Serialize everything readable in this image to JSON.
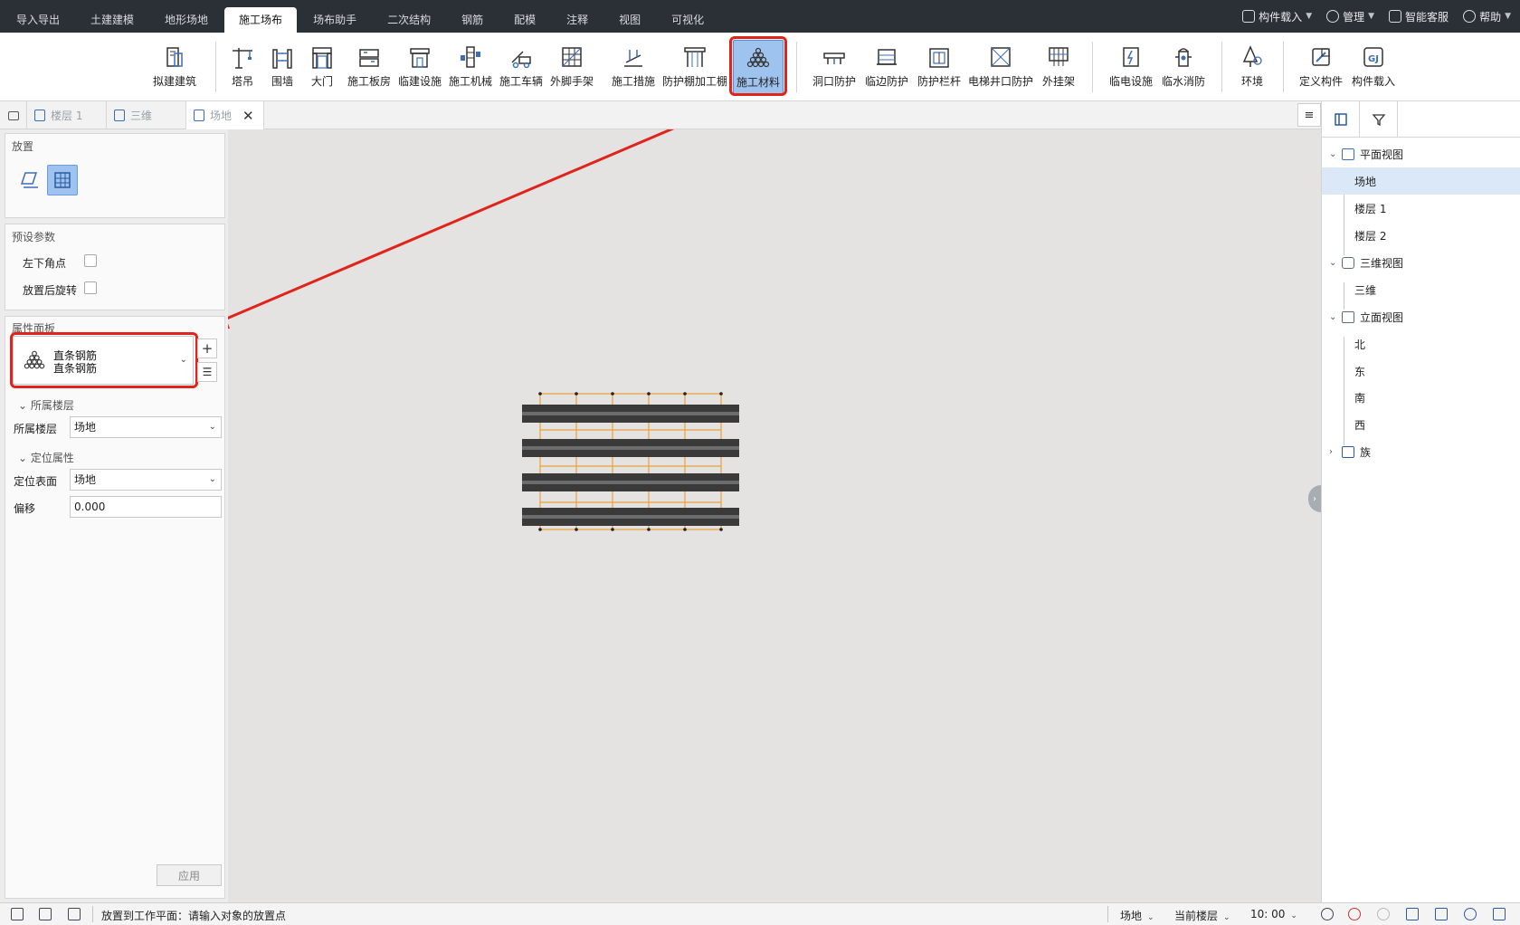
{
  "menubar": {
    "tabs": [
      "导入导出",
      "土建建模",
      "地形场地",
      "施工场布",
      "场布助手",
      "二次结构",
      "钢筋",
      "配模",
      "注释",
      "视图",
      "可视化"
    ],
    "active_tab": "施工场布",
    "right": {
      "component_load": "构件载入",
      "manage": "管理",
      "service": "智能客服",
      "help": "帮助"
    }
  },
  "ribbon": {
    "buttons": [
      "拟建建筑",
      "塔吊",
      "围墙",
      "大门",
      "施工板房",
      "临建设施",
      "施工机械",
      "施工车辆",
      "外脚手架",
      "施工措施",
      "防护棚加工棚",
      "施工材料",
      "洞口防护",
      "临边防护",
      "防护栏杆",
      "电梯井口防护",
      "外挂架",
      "临电设施",
      "临水消防",
      "环境",
      "定义构件",
      "构件载入"
    ],
    "active": "施工材料"
  },
  "doc_tabs": [
    "楼层 1",
    "三维",
    "场地"
  ],
  "active_doc_tab": "场地",
  "left_panel": {
    "place_title": "放置",
    "preset_title": "预设参数",
    "preset_options": [
      "左下角点",
      "放置后旋转"
    ],
    "props_title": "属性面板",
    "type_line1": "直条钢筋",
    "type_line2": "直条钢筋",
    "group_floor": "所属楼层",
    "floor_label": "所属楼层",
    "floor_value": "场地",
    "group_position": "定位属性",
    "surface_label": "定位表面",
    "surface_value": "场地",
    "offset_label": "偏移",
    "offset_value": "0.000",
    "apply_label": "应用"
  },
  "right_panel": {
    "tree": [
      {
        "label": "平面视图",
        "level": 0,
        "expanded": true
      },
      {
        "label": "场地",
        "level": 1,
        "selected": true
      },
      {
        "label": "楼层 1",
        "level": 1
      },
      {
        "label": "楼层 2",
        "level": 1
      },
      {
        "label": "三维视图",
        "level": 0,
        "expanded": true
      },
      {
        "label": "三维",
        "level": 1
      },
      {
        "label": "立面视图",
        "level": 0,
        "expanded": true
      },
      {
        "label": "北",
        "level": 1
      },
      {
        "label": "东",
        "level": 1
      },
      {
        "label": "南",
        "level": 1
      },
      {
        "label": "西",
        "level": 1
      },
      {
        "label": "族",
        "level": 0,
        "expanded": false
      }
    ]
  },
  "statusbar": {
    "message": "放置到工作平面：请输入对象的放置点",
    "site": "场地",
    "floor_mode": "当前楼层",
    "time": "10: 00"
  },
  "colors": {
    "accent": "#9ec3ee",
    "highlight": "#e0241b",
    "rebar_dark": "#3c3c3c",
    "rebar_outline": "#e6a23c"
  },
  "icons": {
    "type_icon": "stacked-rebar-icon"
  }
}
